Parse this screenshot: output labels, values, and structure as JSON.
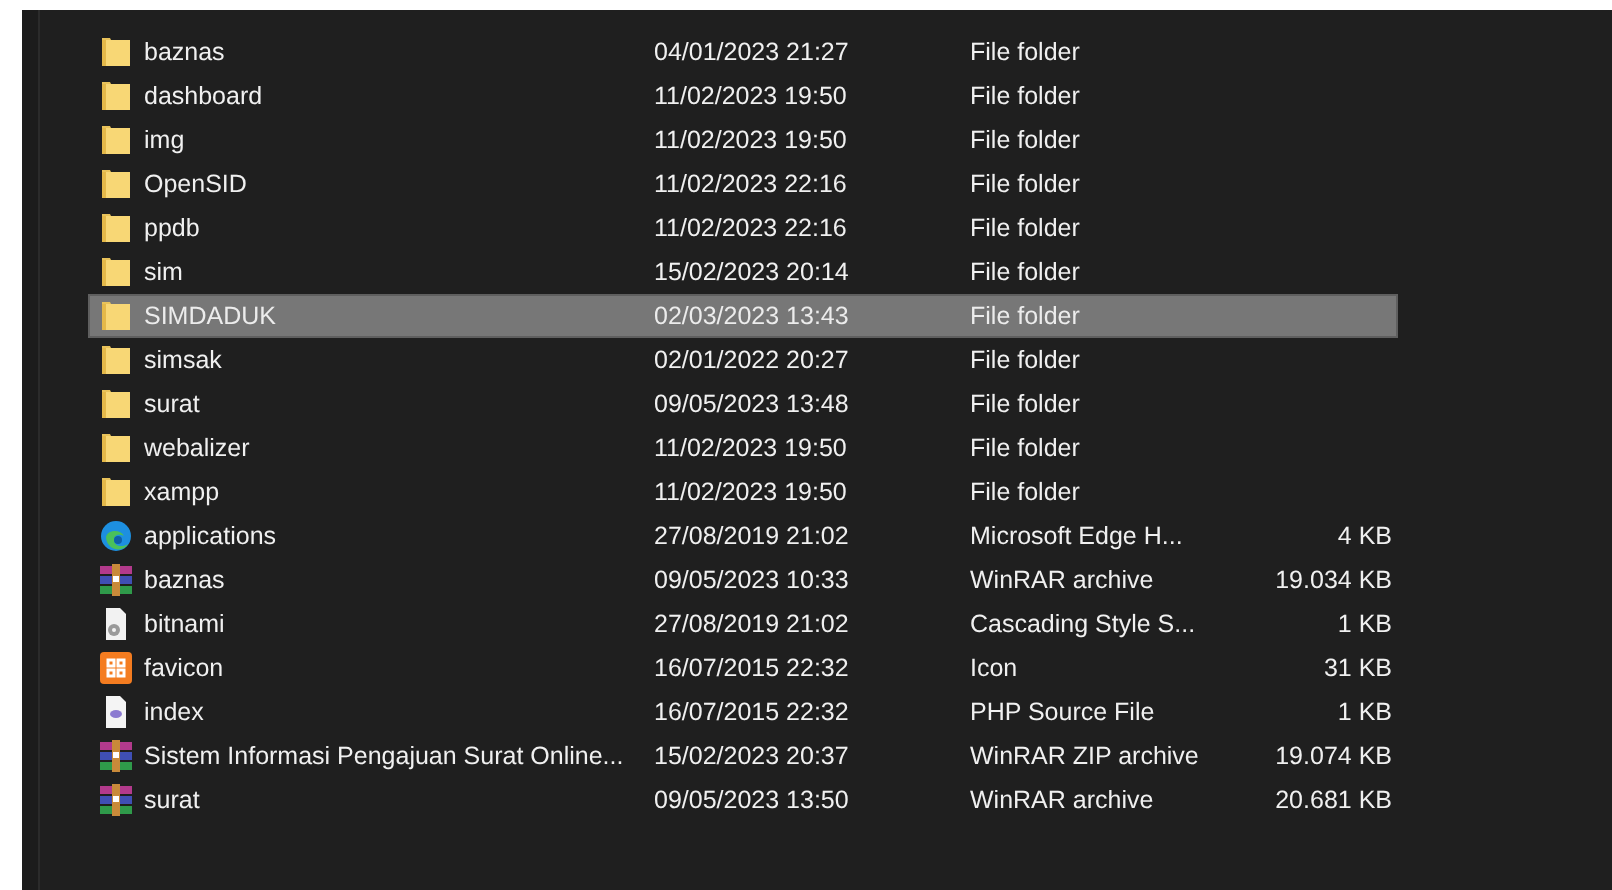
{
  "files": [
    {
      "name": "baznas",
      "date": "04/01/2023 21:27",
      "type": "File folder",
      "kind": "folder",
      "selected": false
    },
    {
      "name": "dashboard",
      "date": "11/02/2023 19:50",
      "type": "File folder",
      "kind": "folder",
      "selected": false
    },
    {
      "name": "img",
      "date": "11/02/2023 19:50",
      "type": "File folder",
      "kind": "folder",
      "selected": false
    },
    {
      "name": "OpenSID",
      "date": "11/02/2023 22:16",
      "type": "File folder",
      "kind": "folder",
      "selected": false
    },
    {
      "name": "ppdb",
      "date": "11/02/2023 22:16",
      "type": "File folder",
      "kind": "folder",
      "selected": false
    },
    {
      "name": "sim",
      "date": "15/02/2023 20:14",
      "type": "File folder",
      "kind": "folder",
      "selected": false
    },
    {
      "name": "SIMDADUK",
      "date": "02/03/2023 13:43",
      "type": "File folder",
      "kind": "folder",
      "selected": true
    },
    {
      "name": "simsak",
      "date": "02/01/2022 20:27",
      "type": "File folder",
      "kind": "folder",
      "selected": false
    },
    {
      "name": "surat",
      "date": "09/05/2023 13:48",
      "type": "File folder",
      "kind": "folder",
      "selected": false
    },
    {
      "name": "webalizer",
      "date": "11/02/2023 19:50",
      "type": "File folder",
      "kind": "folder",
      "selected": false
    },
    {
      "name": "xampp",
      "date": "11/02/2023 19:50",
      "type": "File folder",
      "kind": "folder",
      "selected": false
    },
    {
      "name": "applications",
      "date": "27/08/2019 21:02",
      "type": "Microsoft Edge H...",
      "size": "4 KB",
      "kind": "edge",
      "selected": false
    },
    {
      "name": "baznas",
      "date": "09/05/2023 10:33",
      "type": "WinRAR archive",
      "size": "19.034 KB",
      "kind": "archive",
      "selected": false
    },
    {
      "name": "bitnami",
      "date": "27/08/2019 21:02",
      "type": "Cascading Style S...",
      "size": "1 KB",
      "kind": "stylesheet",
      "selected": false
    },
    {
      "name": "favicon",
      "date": "16/07/2015 22:32",
      "type": "Icon",
      "size": "31 KB",
      "kind": "ico",
      "selected": false
    },
    {
      "name": "index",
      "date": "16/07/2015 22:32",
      "type": "PHP Source File",
      "size": "1 KB",
      "kind": "php",
      "selected": false
    },
    {
      "name": "Sistem Informasi Pengajuan Surat Online...",
      "date": "15/02/2023 20:37",
      "type": "WinRAR ZIP archive",
      "size": "19.074 KB",
      "kind": "archive",
      "selected": false
    },
    {
      "name": "surat",
      "date": "09/05/2023 13:50",
      "type": "WinRAR archive",
      "size": "20.681 KB",
      "kind": "archive",
      "selected": false
    }
  ]
}
